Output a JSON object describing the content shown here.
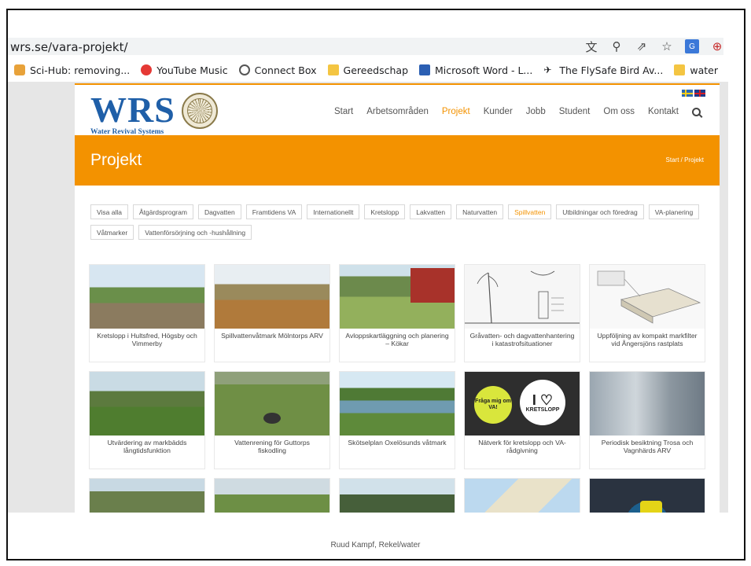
{
  "browser": {
    "url": "wrs.se/vara-projekt/",
    "toolbar_icons": [
      "translate-icon",
      "zoom-icon",
      "share-icon",
      "star-icon",
      "extension-icon",
      "profile-icon"
    ],
    "bookmarks": [
      {
        "label": "Sci-Hub: removing...",
        "icon": "scihub-icon"
      },
      {
        "label": "YouTube Music",
        "icon": "youtube-music-icon"
      },
      {
        "label": "Connect Box",
        "icon": "globe-icon"
      },
      {
        "label": "Gereedschap",
        "icon": "folder-icon"
      },
      {
        "label": "Microsoft Word - L...",
        "icon": "word-icon"
      },
      {
        "label": "The FlySafe Bird Av...",
        "icon": "bird-icon"
      },
      {
        "label": "water",
        "icon": "folder-icon"
      }
    ]
  },
  "site": {
    "logo": "WRS",
    "logo_sub": "Water Revival Systems",
    "nav": [
      {
        "label": "Start",
        "active": false
      },
      {
        "label": "Arbetsområden",
        "active": false
      },
      {
        "label": "Projekt",
        "active": true
      },
      {
        "label": "Kunder",
        "active": false
      },
      {
        "label": "Jobb",
        "active": false
      },
      {
        "label": "Student",
        "active": false
      },
      {
        "label": "Om oss",
        "active": false
      },
      {
        "label": "Kontakt",
        "active": false
      }
    ],
    "banner_title": "Projekt",
    "breadcrumb": "Start  /  Projekt",
    "filters": [
      {
        "label": "Visa alla",
        "active": false
      },
      {
        "label": "Åtgärdsprogram",
        "active": false
      },
      {
        "label": "Dagvatten",
        "active": false
      },
      {
        "label": "Framtidens VA",
        "active": false
      },
      {
        "label": "Internationellt",
        "active": false
      },
      {
        "label": "Kretslopp",
        "active": false
      },
      {
        "label": "Lakvatten",
        "active": false
      },
      {
        "label": "Naturvatten",
        "active": false
      },
      {
        "label": "Spillvatten",
        "active": true
      },
      {
        "label": "Utbildningar och föredrag",
        "active": false
      },
      {
        "label": "VA-planering",
        "active": false
      },
      {
        "label": "Våtmarker",
        "active": false
      },
      {
        "label": "Vattenförsörjning och -hushållning",
        "active": false
      }
    ],
    "projects": [
      {
        "title": "Kretslopp i Hultsfred, Högsby och Vimmerby"
      },
      {
        "title": "Spillvattenvåtmark Mölntorps ARV"
      },
      {
        "title": "Avloppskartläggning och planering – Kökar"
      },
      {
        "title": "Gråvatten- och dagvattenhantering i katastrofsituationer"
      },
      {
        "title": "Uppföljning av kompakt markfilter vid Ångersjöns rastplats"
      },
      {
        "title": "Utvärdering av markbädds långtidsfunktion"
      },
      {
        "title": "Vattenrening för Guttorps fiskodling"
      },
      {
        "title": "Skötselplan Oxelösunds våtmark"
      },
      {
        "title": "Nätverk för kretslopp och VA-rådgivning"
      },
      {
        "title": "Periodisk besiktning Trosa och Vagnhärds ARV"
      }
    ],
    "badge1": "Fråga mig om VA!",
    "badge2_big": "I ♡",
    "badge2_small": "KRETSLOPP"
  },
  "slide_caption": "Ruud Kampf, Rekel/water",
  "colors": {
    "accent": "#f39200",
    "brand": "#1f5fa8"
  }
}
